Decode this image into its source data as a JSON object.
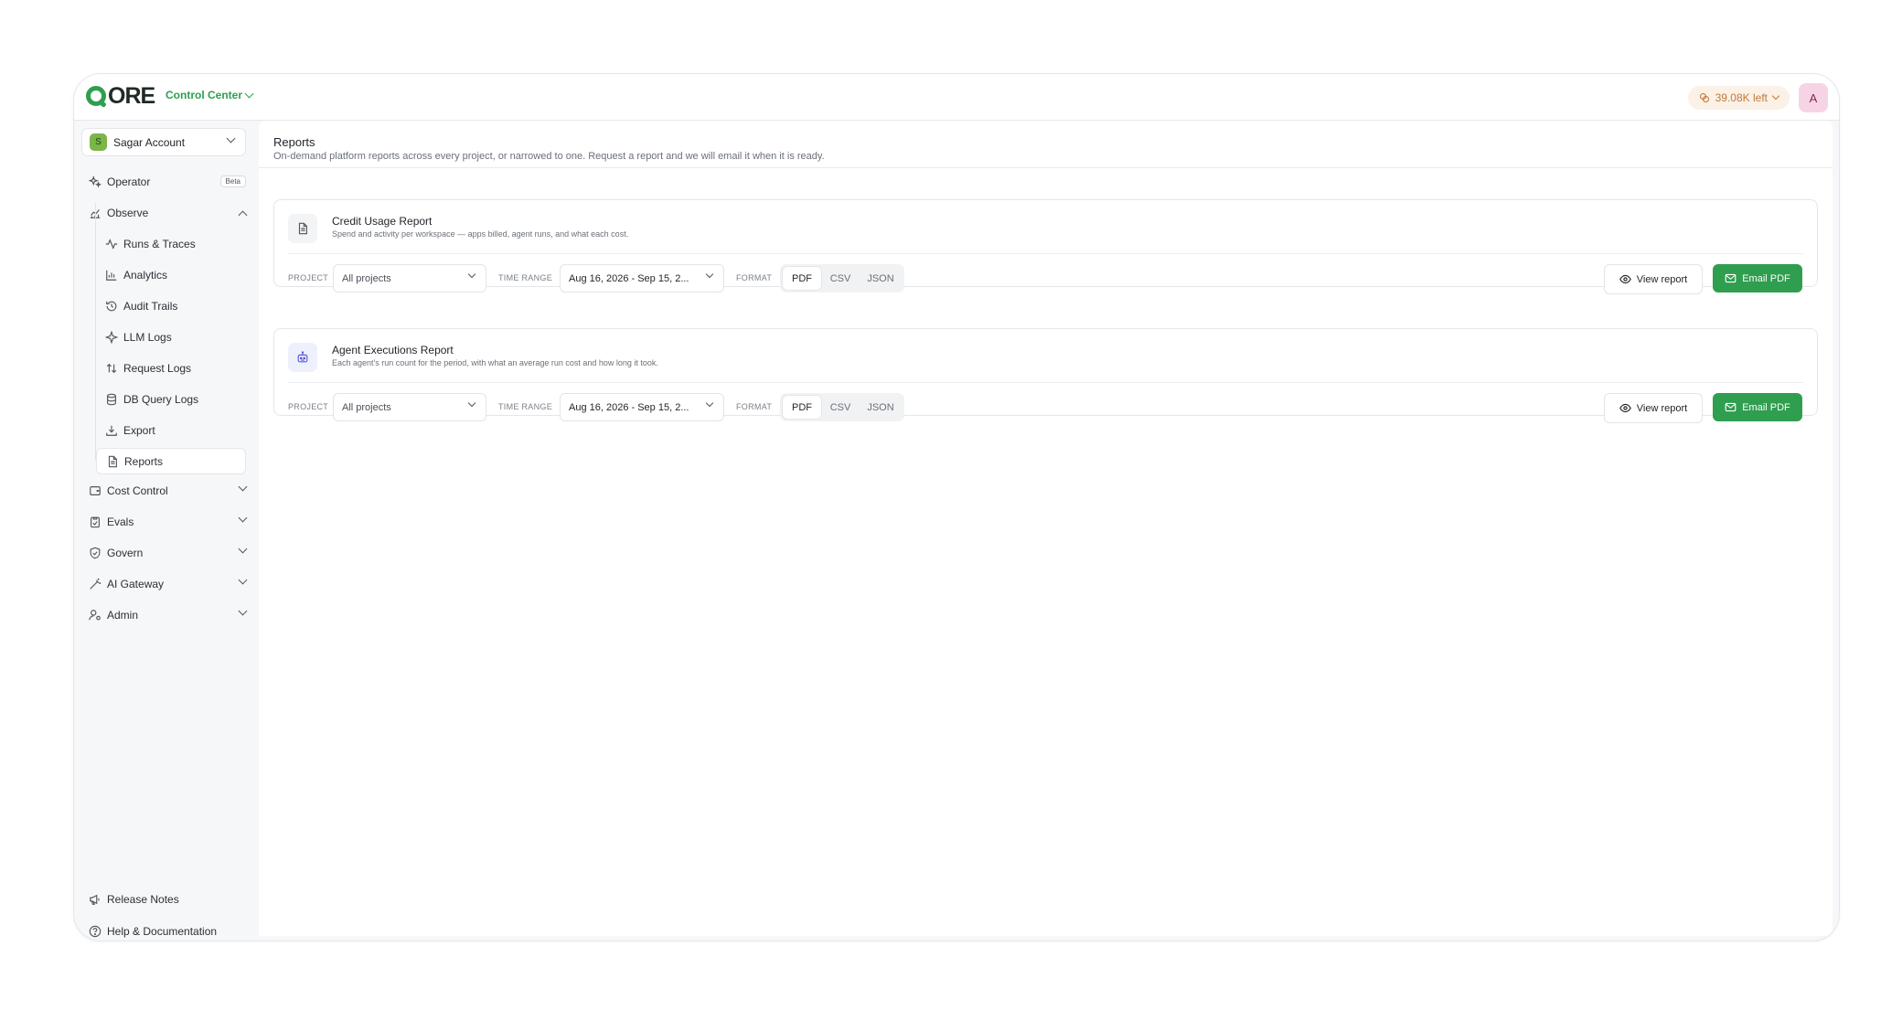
{
  "brand": {
    "logo_text": "ORE",
    "app_switcher": "Control Center"
  },
  "header": {
    "credits": "39.08K left",
    "avatar_initial": "A"
  },
  "account": {
    "initial": "S",
    "name": "Sagar Account"
  },
  "sidebar": {
    "operator": {
      "label": "Operator",
      "badge": "Beta"
    },
    "observe": {
      "label": "Observe",
      "items": [
        "Runs & Traces",
        "Analytics",
        "Audit Trails",
        "LLM Logs",
        "Request Logs",
        "DB Query Logs",
        "Export",
        "Reports"
      ]
    },
    "sections": [
      "Cost Control",
      "Evals",
      "Govern",
      "AI Gateway",
      "Admin"
    ],
    "footer": [
      "Release Notes",
      "Help & Documentation"
    ]
  },
  "page": {
    "title": "Reports",
    "subtitle": "On-demand platform reports across every project, or narrowed to one. Request a report and we will email it when it is ready."
  },
  "reports": [
    {
      "title": "Credit Usage Report",
      "description": "Spend and activity per workspace — apps billed, agent runs, and what each cost.",
      "icon": "document-icon"
    },
    {
      "title": "Agent Executions Report",
      "description": "Each agent's run count for the period, with what an average run cost and how long it took.",
      "icon": "robot-icon"
    }
  ],
  "controls": {
    "project_label": "PROJECT",
    "project_value": "All projects",
    "time_label": "TIME RANGE",
    "time_value": "Aug 16, 2026 - Sep 15, 2...",
    "format_label": "FORMAT",
    "formats": [
      "PDF",
      "CSV",
      "JSON"
    ],
    "selected_format": "PDF",
    "view_label": "View report",
    "email_label": "Email PDF"
  },
  "colors": {
    "accent": "#2f9e4f",
    "credits_bg": "#fbf1e6",
    "avatar_bg": "#f7d3e6"
  }
}
